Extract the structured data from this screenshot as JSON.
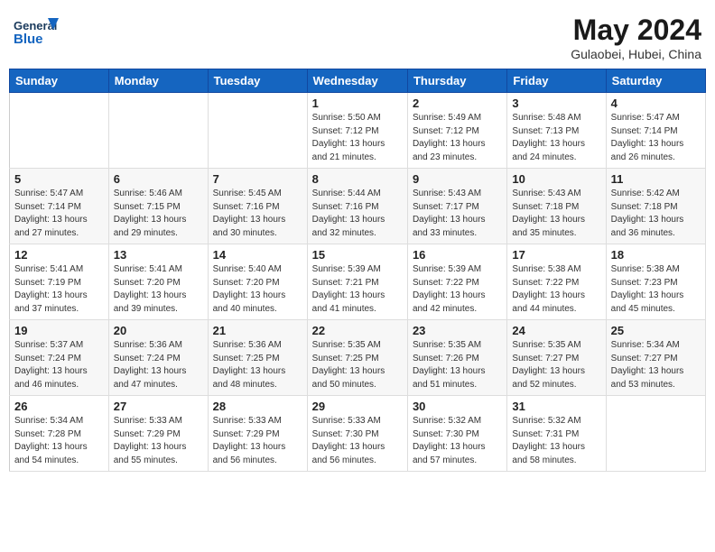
{
  "header": {
    "logo_general": "General",
    "logo_blue": "Blue",
    "month_year": "May 2024",
    "location": "Gulaobei, Hubei, China"
  },
  "weekdays": [
    "Sunday",
    "Monday",
    "Tuesday",
    "Wednesday",
    "Thursday",
    "Friday",
    "Saturday"
  ],
  "weeks": [
    [
      {
        "day": "",
        "info": ""
      },
      {
        "day": "",
        "info": ""
      },
      {
        "day": "",
        "info": ""
      },
      {
        "day": "1",
        "info": "Sunrise: 5:50 AM\nSunset: 7:12 PM\nDaylight: 13 hours\nand 21 minutes."
      },
      {
        "day": "2",
        "info": "Sunrise: 5:49 AM\nSunset: 7:12 PM\nDaylight: 13 hours\nand 23 minutes."
      },
      {
        "day": "3",
        "info": "Sunrise: 5:48 AM\nSunset: 7:13 PM\nDaylight: 13 hours\nand 24 minutes."
      },
      {
        "day": "4",
        "info": "Sunrise: 5:47 AM\nSunset: 7:14 PM\nDaylight: 13 hours\nand 26 minutes."
      }
    ],
    [
      {
        "day": "5",
        "info": "Sunrise: 5:47 AM\nSunset: 7:14 PM\nDaylight: 13 hours\nand 27 minutes."
      },
      {
        "day": "6",
        "info": "Sunrise: 5:46 AM\nSunset: 7:15 PM\nDaylight: 13 hours\nand 29 minutes."
      },
      {
        "day": "7",
        "info": "Sunrise: 5:45 AM\nSunset: 7:16 PM\nDaylight: 13 hours\nand 30 minutes."
      },
      {
        "day": "8",
        "info": "Sunrise: 5:44 AM\nSunset: 7:16 PM\nDaylight: 13 hours\nand 32 minutes."
      },
      {
        "day": "9",
        "info": "Sunrise: 5:43 AM\nSunset: 7:17 PM\nDaylight: 13 hours\nand 33 minutes."
      },
      {
        "day": "10",
        "info": "Sunrise: 5:43 AM\nSunset: 7:18 PM\nDaylight: 13 hours\nand 35 minutes."
      },
      {
        "day": "11",
        "info": "Sunrise: 5:42 AM\nSunset: 7:18 PM\nDaylight: 13 hours\nand 36 minutes."
      }
    ],
    [
      {
        "day": "12",
        "info": "Sunrise: 5:41 AM\nSunset: 7:19 PM\nDaylight: 13 hours\nand 37 minutes."
      },
      {
        "day": "13",
        "info": "Sunrise: 5:41 AM\nSunset: 7:20 PM\nDaylight: 13 hours\nand 39 minutes."
      },
      {
        "day": "14",
        "info": "Sunrise: 5:40 AM\nSunset: 7:20 PM\nDaylight: 13 hours\nand 40 minutes."
      },
      {
        "day": "15",
        "info": "Sunrise: 5:39 AM\nSunset: 7:21 PM\nDaylight: 13 hours\nand 41 minutes."
      },
      {
        "day": "16",
        "info": "Sunrise: 5:39 AM\nSunset: 7:22 PM\nDaylight: 13 hours\nand 42 minutes."
      },
      {
        "day": "17",
        "info": "Sunrise: 5:38 AM\nSunset: 7:22 PM\nDaylight: 13 hours\nand 44 minutes."
      },
      {
        "day": "18",
        "info": "Sunrise: 5:38 AM\nSunset: 7:23 PM\nDaylight: 13 hours\nand 45 minutes."
      }
    ],
    [
      {
        "day": "19",
        "info": "Sunrise: 5:37 AM\nSunset: 7:24 PM\nDaylight: 13 hours\nand 46 minutes."
      },
      {
        "day": "20",
        "info": "Sunrise: 5:36 AM\nSunset: 7:24 PM\nDaylight: 13 hours\nand 47 minutes."
      },
      {
        "day": "21",
        "info": "Sunrise: 5:36 AM\nSunset: 7:25 PM\nDaylight: 13 hours\nand 48 minutes."
      },
      {
        "day": "22",
        "info": "Sunrise: 5:35 AM\nSunset: 7:25 PM\nDaylight: 13 hours\nand 50 minutes."
      },
      {
        "day": "23",
        "info": "Sunrise: 5:35 AM\nSunset: 7:26 PM\nDaylight: 13 hours\nand 51 minutes."
      },
      {
        "day": "24",
        "info": "Sunrise: 5:35 AM\nSunset: 7:27 PM\nDaylight: 13 hours\nand 52 minutes."
      },
      {
        "day": "25",
        "info": "Sunrise: 5:34 AM\nSunset: 7:27 PM\nDaylight: 13 hours\nand 53 minutes."
      }
    ],
    [
      {
        "day": "26",
        "info": "Sunrise: 5:34 AM\nSunset: 7:28 PM\nDaylight: 13 hours\nand 54 minutes."
      },
      {
        "day": "27",
        "info": "Sunrise: 5:33 AM\nSunset: 7:29 PM\nDaylight: 13 hours\nand 55 minutes."
      },
      {
        "day": "28",
        "info": "Sunrise: 5:33 AM\nSunset: 7:29 PM\nDaylight: 13 hours\nand 56 minutes."
      },
      {
        "day": "29",
        "info": "Sunrise: 5:33 AM\nSunset: 7:30 PM\nDaylight: 13 hours\nand 56 minutes."
      },
      {
        "day": "30",
        "info": "Sunrise: 5:32 AM\nSunset: 7:30 PM\nDaylight: 13 hours\nand 57 minutes."
      },
      {
        "day": "31",
        "info": "Sunrise: 5:32 AM\nSunset: 7:31 PM\nDaylight: 13 hours\nand 58 minutes."
      },
      {
        "day": "",
        "info": ""
      }
    ]
  ]
}
